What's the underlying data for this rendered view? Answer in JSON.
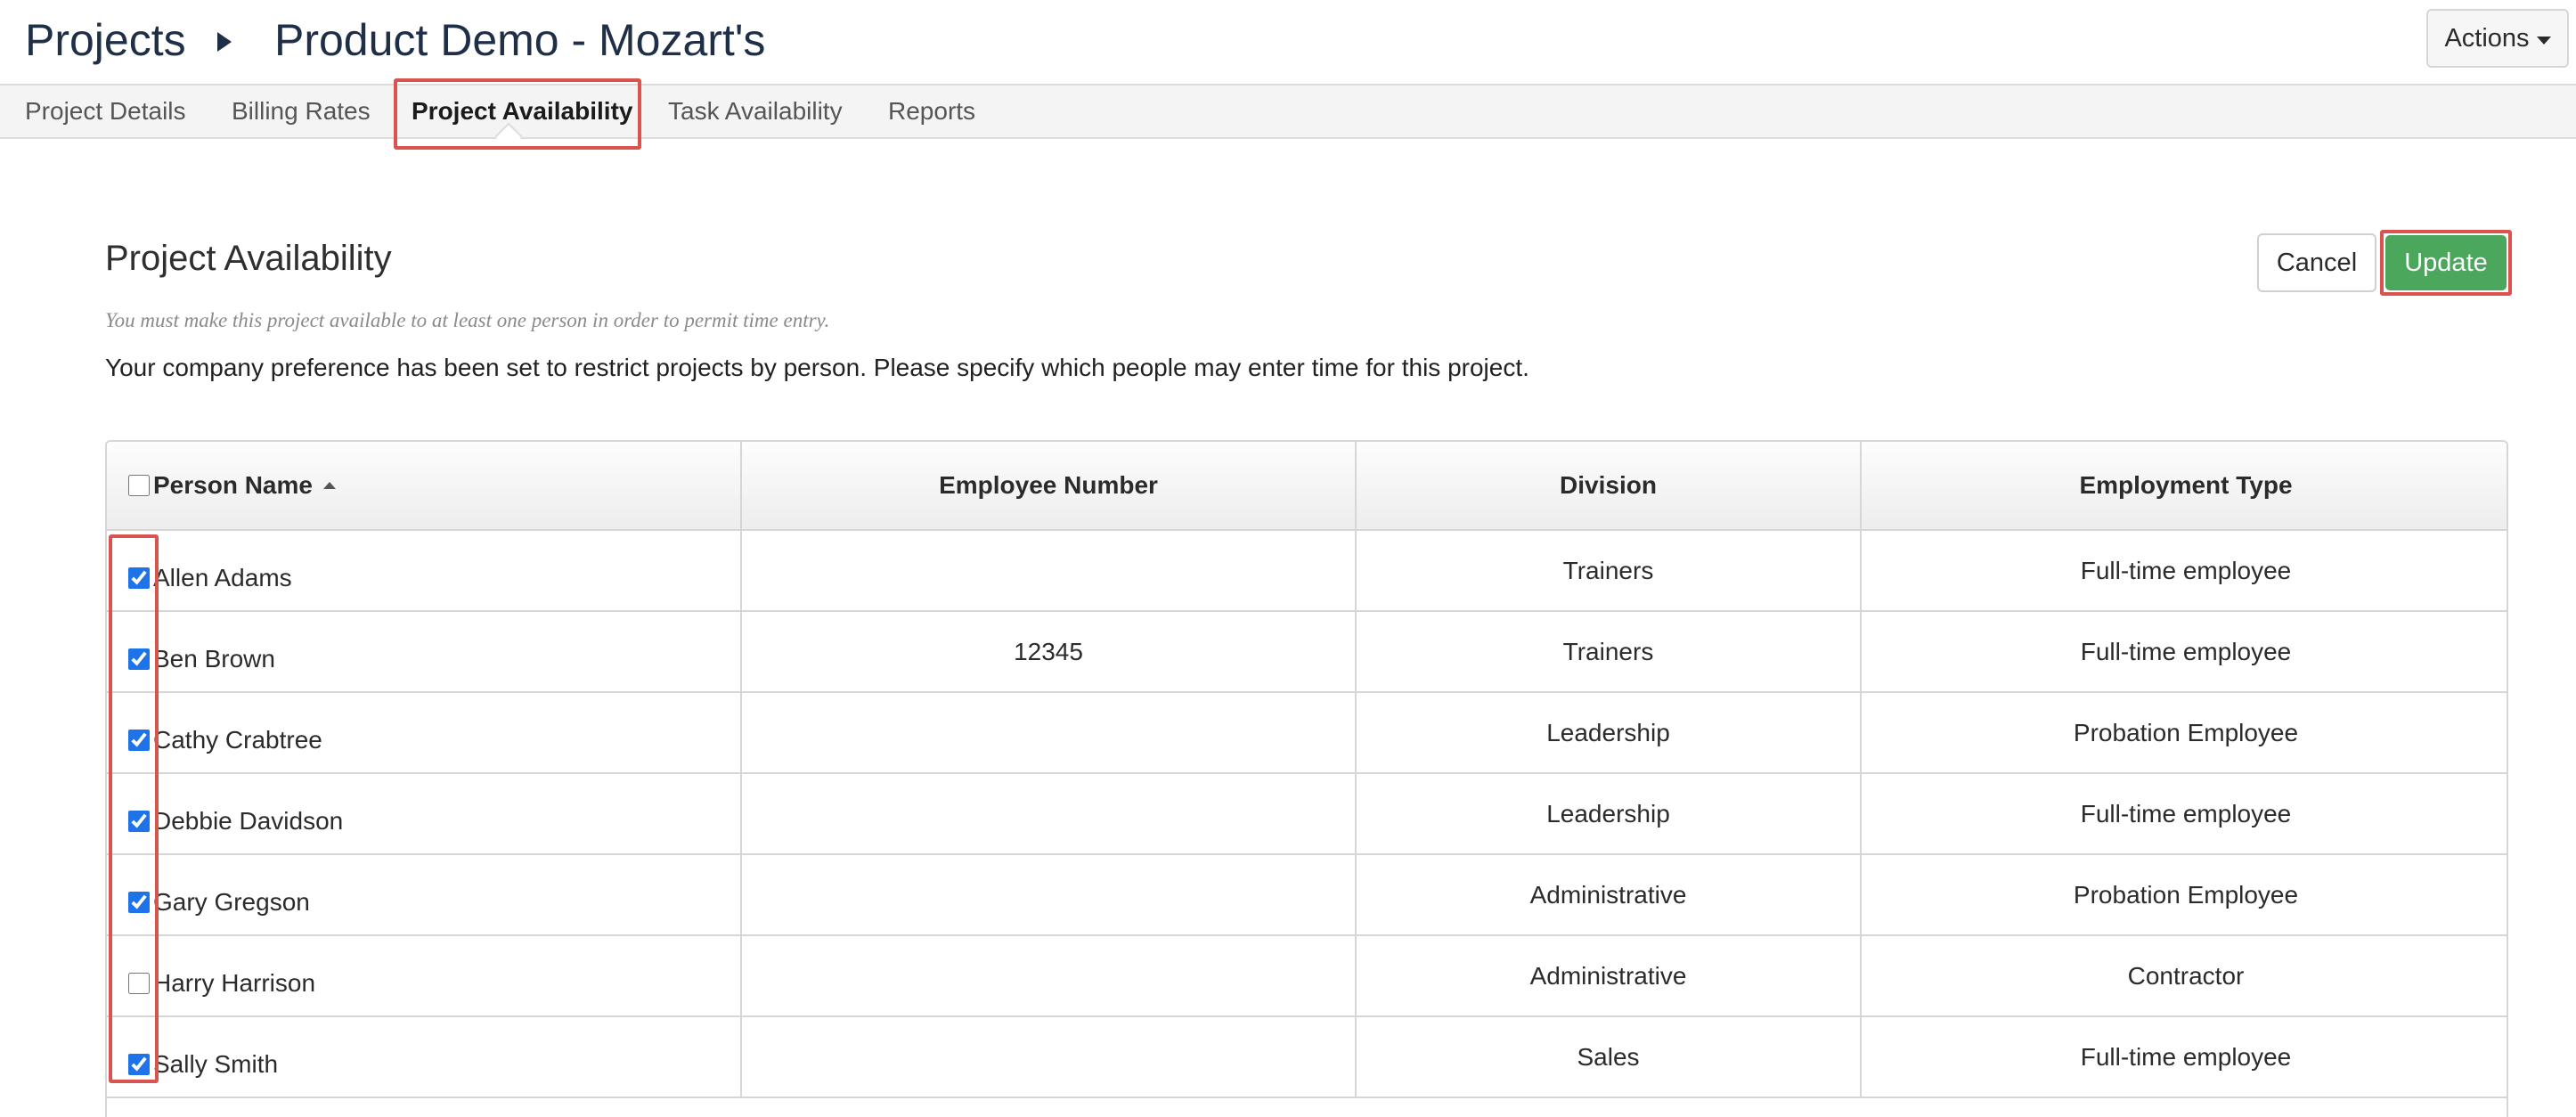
{
  "breadcrumb": {
    "root": "Projects",
    "current": "Product Demo - Mozart's"
  },
  "actions_label": "Actions",
  "tabs": [
    {
      "label": "Project Details",
      "active": false
    },
    {
      "label": "Billing Rates",
      "active": false
    },
    {
      "label": "Project Availability",
      "active": true
    },
    {
      "label": "Task Availability",
      "active": false
    },
    {
      "label": "Reports",
      "active": false
    }
  ],
  "section": {
    "title": "Project Availability",
    "hint": "You must make this project available to at least one person in order to permit time entry.",
    "description": "Your company preference has been set to restrict projects by person. Please specify which people may enter time for this project.",
    "cancel_label": "Cancel",
    "update_label": "Update"
  },
  "table": {
    "columns": [
      "Person Name",
      "Employee Number",
      "Division",
      "Employment Type"
    ],
    "select_all_checked": false,
    "rows": [
      {
        "checked": true,
        "name": "Allen Adams",
        "employee_number": "",
        "division": "Trainers",
        "employment_type": "Full-time employee"
      },
      {
        "checked": true,
        "name": "Ben Brown",
        "employee_number": "12345",
        "division": "Trainers",
        "employment_type": "Full-time employee"
      },
      {
        "checked": true,
        "name": "Cathy Crabtree",
        "employee_number": "",
        "division": "Leadership",
        "employment_type": "Probation Employee"
      },
      {
        "checked": true,
        "name": "Debbie Davidson",
        "employee_number": "",
        "division": "Leadership",
        "employment_type": "Full-time employee"
      },
      {
        "checked": true,
        "name": "Gary Gregson",
        "employee_number": "",
        "division": "Administrative",
        "employment_type": "Probation Employee"
      },
      {
        "checked": false,
        "name": "Harry Harrison",
        "employee_number": "",
        "division": "Administrative",
        "employment_type": "Contractor"
      },
      {
        "checked": true,
        "name": "Sally Smith",
        "employee_number": "",
        "division": "Sales",
        "employment_type": "Full-time employee"
      }
    ]
  },
  "colors": {
    "update_button": "#4aa75c",
    "highlight": "#d9534f",
    "title_text": "#1f2f48"
  }
}
